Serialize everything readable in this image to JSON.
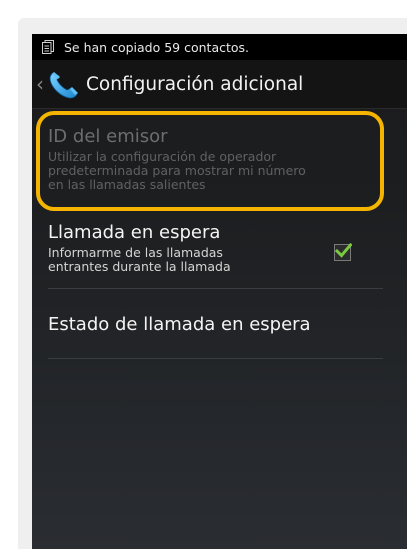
{
  "status_bar": {
    "notification_text": "Se han copiado 59 contactos."
  },
  "action_bar": {
    "title": "Configuración adicional"
  },
  "preferences": [
    {
      "title": "ID del emisor",
      "summary_lines": [
        "Utilizar la configuración de operador",
        "predeterminada para mostrar mi número",
        "en las llamadas salientes"
      ],
      "enabled": false
    },
    {
      "title": "Llamada en espera",
      "summary_lines": [
        "Informarme de las llamadas",
        "entrantes durante la llamada"
      ],
      "enabled": true,
      "checked": true
    },
    {
      "title": "Estado de llamada en espera",
      "enabled": true
    }
  ],
  "colors": {
    "highlight": "#f4b400",
    "check": "#7ac943",
    "background": "#1c1d1f"
  }
}
